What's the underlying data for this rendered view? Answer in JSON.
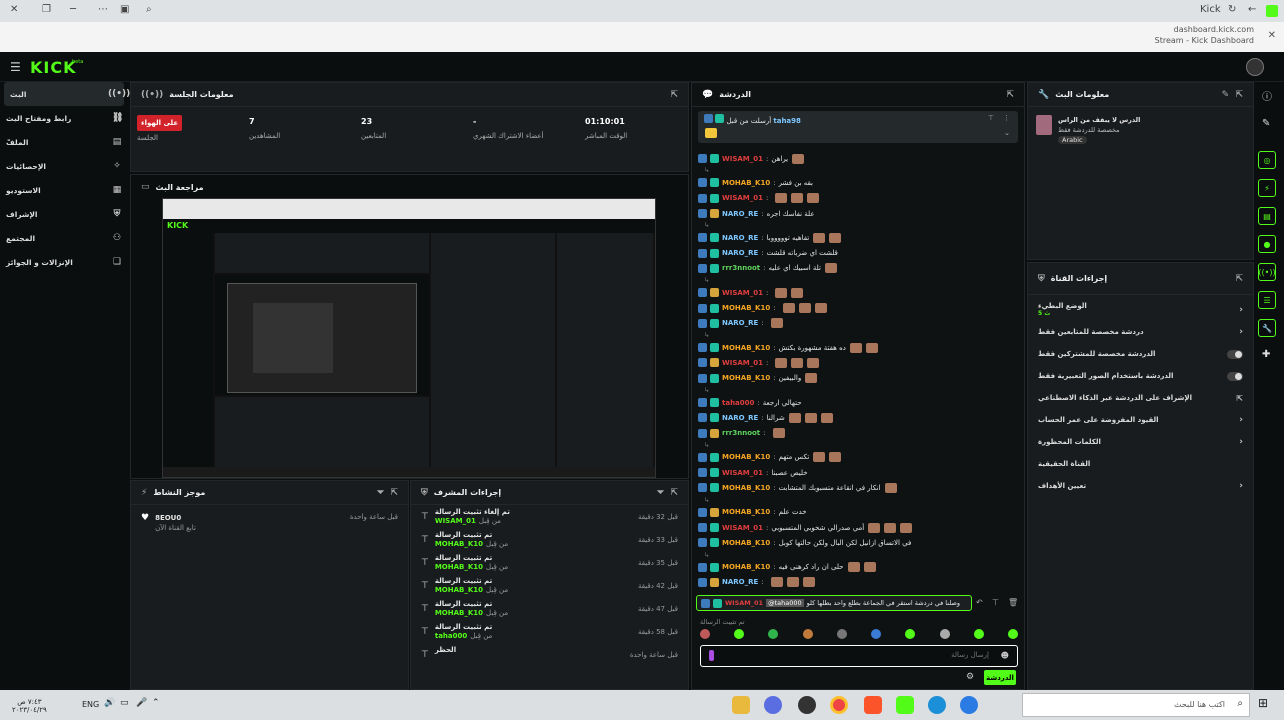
{
  "browser": {
    "title": "Stream - Kick Dashboard",
    "url": "dashboard.kick.com",
    "site": "Kick"
  },
  "header": {
    "logo": "KICK",
    "logo_sup": "beta"
  },
  "sidebar": {
    "items": [
      {
        "label": "البث",
        "icon": "live-icon",
        "active": true
      },
      {
        "label": "رابط ومفتاح البث",
        "icon": "key-icon"
      },
      {
        "label": "الملفّ",
        "icon": "file-icon"
      },
      {
        "label": "الإحصائيات",
        "icon": "chart-icon"
      },
      {
        "label": "الاستوديو",
        "icon": "studio-icon"
      },
      {
        "label": "الإشراف",
        "icon": "shield-icon"
      },
      {
        "label": "المجتمع",
        "icon": "community-icon"
      },
      {
        "label": "الإنزالات و الجوائز",
        "icon": "gift-icon"
      }
    ]
  },
  "session": {
    "title": "معلومات الجلسة",
    "live": "على الهواء",
    "live_label": "الجلسة",
    "followers_v": "7",
    "followers_l": "المشاهدين",
    "viewers_v": "23",
    "viewers_l": "المتابعين",
    "subs_v": "-",
    "subs_l": "أعضاء الاشتراك الشهري",
    "uptime_v": "01:10:01",
    "uptime_l": "الوقت المباشر"
  },
  "preview": {
    "title": "مراجعة البث"
  },
  "activity": {
    "title": "موجز النشاط",
    "user": "8EOU0",
    "desc": "تابع القناة الآن",
    "time": "قبل ساعة واحدة"
  },
  "modactions": {
    "title": "إجراءات المشرف",
    "rows": [
      {
        "action": "تم إلغاء تثبيت الرسالة",
        "user": "WISAM_01",
        "by": "من قِبل",
        "time": "قبل 32 دقيقة"
      },
      {
        "action": "تم تثبيت الرسالة",
        "user": "MOHAB_K10",
        "by": "من قِبل",
        "time": "قبل 33 دقيقة"
      },
      {
        "action": "تم تثبيت الرسالة",
        "user": "MOHAB_K10",
        "by": "من قِبل",
        "time": "قبل 35 دقيقة"
      },
      {
        "action": "تم تثبيت الرسالة",
        "user": "MOHAB_K10",
        "by": "من قِبل",
        "time": "قبل 42 دقيقة"
      },
      {
        "action": "تم تثبيت الرسالة",
        "user": "MOHAB_K10",
        "by": "من قِبل",
        "time": "قبل 47 دقيقة"
      },
      {
        "action": "تم تثبيت الرسالة",
        "user": "taha000",
        "by": "من قِبل",
        "time": "قبل 58 دقيقة"
      },
      {
        "action": "الحظر",
        "user": "",
        "by": "",
        "time": "قبل ساعة واحدة"
      }
    ]
  },
  "chat": {
    "title": "الدردشة",
    "pinned_label": "أرسلت من قبل",
    "pinned_user": "taha98",
    "messages": [
      {
        "user": "WISAM_01",
        "color": "#e03e3e",
        "text": "يراهن"
      },
      {
        "user": "MOHAB_K10",
        "color": "#f5a623",
        "text": "بقه بن فشر"
      },
      {
        "user": "WISAM_01",
        "color": "#e03e3e",
        "text": ""
      },
      {
        "user": "NARO_RE",
        "color": "#7ec8ff",
        "text": "علة نفاسك اجره"
      },
      {
        "user": "NARO_RE",
        "color": "#7ec8ff",
        "text": "تفاهيه توووووبا"
      },
      {
        "user": "NARO_RE",
        "color": "#7ec8ff",
        "text": "قلشت اي ضرباته قلشت"
      },
      {
        "user": "rrr3nnoot",
        "color": "#5fd35f",
        "text": "تلة اسبيك اي عليه"
      },
      {
        "user": "WISAM_01",
        "color": "#e03e3e",
        "text": ""
      },
      {
        "user": "MOHAB_K10",
        "color": "#f5a623",
        "text": ""
      },
      {
        "user": "NARO_RE",
        "color": "#7ec8ff",
        "text": ""
      },
      {
        "user": "MOHAB_K10",
        "color": "#f5a623",
        "text": "ده هفتة مشهورة بكتش"
      },
      {
        "user": "WISAM_01",
        "color": "#e03e3e",
        "text": ""
      },
      {
        "user": "MOHAB_K10",
        "color": "#f5a623",
        "text": "والبيفين"
      },
      {
        "user": "taha000",
        "color": "#e03e3e",
        "text": "حتهالي ارجعة"
      },
      {
        "user": "NARO_RE",
        "color": "#7ec8ff",
        "text": "شرالنا"
      },
      {
        "user": "rrr3nnoot",
        "color": "#5fd35f",
        "text": ""
      },
      {
        "user": "MOHAB_K10",
        "color": "#f5a623",
        "text": "تكس متهم"
      },
      {
        "user": "WISAM_01",
        "color": "#e03e3e",
        "text": "خليص عصبنا"
      },
      {
        "user": "MOHAB_K10",
        "color": "#f5a623",
        "text": "انكار في انقاعة متسبوبك المتشابت"
      },
      {
        "user": "MOHAB_K10",
        "color": "#f5a623",
        "text": "خدت علم"
      },
      {
        "user": "WISAM_01",
        "color": "#e03e3e",
        "text": "أمي صدرالي شخوبي المتسبوبي"
      },
      {
        "user": "MOHAB_K10",
        "color": "#f5a623",
        "text": "في الاتساق ازانيل لكن البال ولكن حالتها كوبل"
      },
      {
        "user": "MOHAB_K10",
        "color": "#f5a623",
        "text": "حلى ان راد كرهنى فيه"
      },
      {
        "user": "NARO_RE",
        "color": "#7ec8ff",
        "text": ""
      }
    ],
    "highlight": {
      "user": "WISAM_01",
      "mention": "@taha000",
      "text": "وصلنا في دردشة استقر في الجماعة بطلع واحد بطلها كلو"
    },
    "pinned_by": "تم تثبيت الرسالة",
    "placeholder": "إرسال رسالة",
    "send": "الدردشة"
  },
  "streaminfo": {
    "title": "معلومات البث",
    "stream_title": "الدرس لا يبقف من الراس",
    "category": "مخصصة للدردشة فقط",
    "lang": "Arabic"
  },
  "channel": {
    "title": "إجراءات القناة",
    "rows": [
      {
        "label": "الوضع البطيء",
        "sub": "5 ث",
        "type": "arrow"
      },
      {
        "label": "دردشة مخصصة للمتابعين فقط",
        "type": "arrow"
      },
      {
        "label": "الدردشة مخصصة للمشتركين فقط",
        "type": "toggle"
      },
      {
        "label": "الدردشة باستخدام الصور التعبيرية فقط",
        "type": "toggle"
      },
      {
        "label": "الإشراف على الدردشة عبر الذكاء الاصطناعي",
        "type": "ext"
      },
      {
        "label": "القيود المفروضة على عمر الحساب",
        "type": "arrow"
      },
      {
        "label": "الكلمات المحظورة",
        "type": "arrow"
      },
      {
        "label": "القناة الحقيقية",
        "type": "none"
      },
      {
        "label": "تعيين الأهداف",
        "type": "arrow"
      }
    ]
  },
  "taskbar": {
    "search": "اكتب هنا للبحث",
    "lang": "ENG",
    "time": "٧:٤٣ ص",
    "date": "٢٠٢٣/٠٤/٢٩"
  },
  "colors": {
    "accent": "#53fc18",
    "panel": "#191c1e",
    "bg": "#0b0e0f",
    "live": "#d3232a"
  }
}
